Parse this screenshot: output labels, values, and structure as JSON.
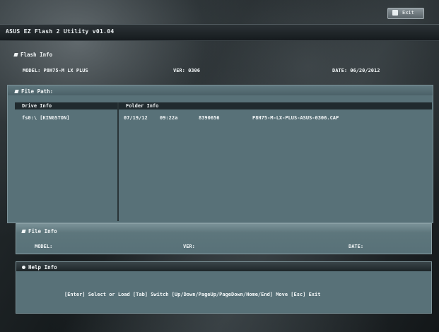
{
  "title_bar": {
    "title": "ASUS EZ Flash 2 Utility v01.04"
  },
  "exit_button": {
    "label": "Exit",
    "icon": "exit-icon"
  },
  "flash_info": {
    "heading": "Flash Info",
    "model": "MODEL: P8H75-M LX PLUS",
    "ver": "VER: 0306",
    "date": "DATE: 06/20/2012"
  },
  "file_path": {
    "heading": "File Path:",
    "drive_header": "Drive Info",
    "folder_header": "Folder Info",
    "drive_item": "fs0:\\ [KINGSTON]",
    "folder_item": {
      "date": "07/19/12",
      "time": "09:22a",
      "size": "8390656",
      "name": "P8H75-M-LX-PLUS-ASUS-0306.CAP"
    }
  },
  "file_info": {
    "heading": "File Info",
    "model": "MODEL:",
    "ver": "VER:",
    "date": "DATE:"
  },
  "help_info": {
    "heading": "Help Info",
    "text": "[Enter] Select or Load   [Tab] Switch   [Up/Down/PageUp/PageDown/Home/End] Move   [Esc] Exit"
  }
}
